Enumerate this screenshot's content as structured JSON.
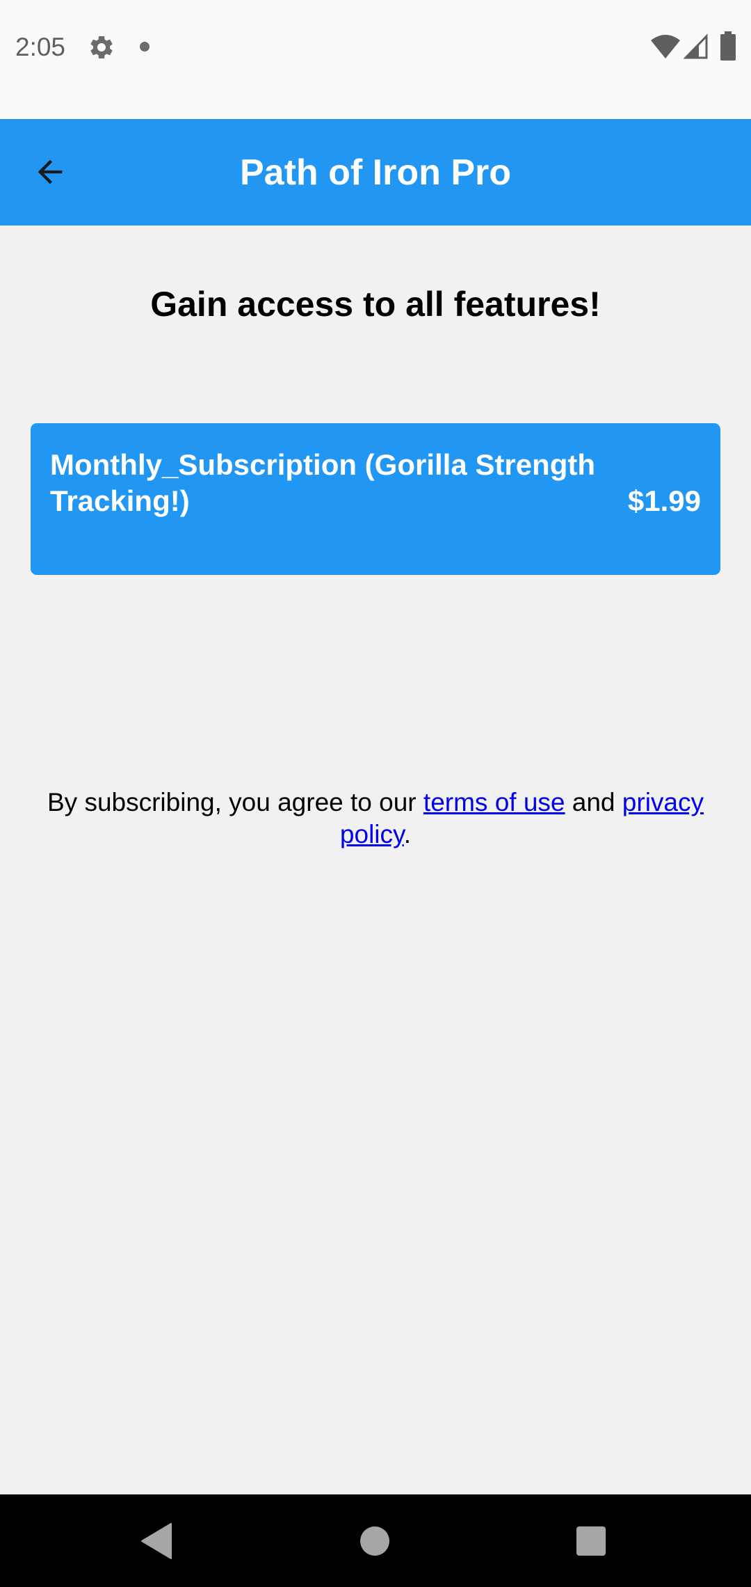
{
  "status_bar": {
    "time": "2:05",
    "icons": [
      "gear-icon",
      "notification-dot-icon",
      "wifi-icon",
      "cell-signal-icon",
      "battery-icon"
    ]
  },
  "app_bar": {
    "title": "Path of Iron Pro",
    "back_icon": "arrow-left-icon"
  },
  "main": {
    "headline": "Gain access to all features!",
    "subscription": {
      "name": "Monthly_Subscription (Gorilla Strength Tracking!)",
      "price": "$1.99"
    },
    "terms": {
      "prefix": "By subscribing, you agree to our ",
      "terms_link": "terms of use",
      "middle": " and ",
      "privacy_link": "privacy policy",
      "suffix": "."
    }
  },
  "nav_bar": {
    "icons": [
      "nav-back-icon",
      "nav-home-icon",
      "nav-recents-icon"
    ]
  },
  "colors": {
    "primary": "#2196f3",
    "background": "#f1f1f1",
    "link": "#0000ee",
    "status_bar": "#fafafa",
    "nav_bar": "#000000"
  }
}
